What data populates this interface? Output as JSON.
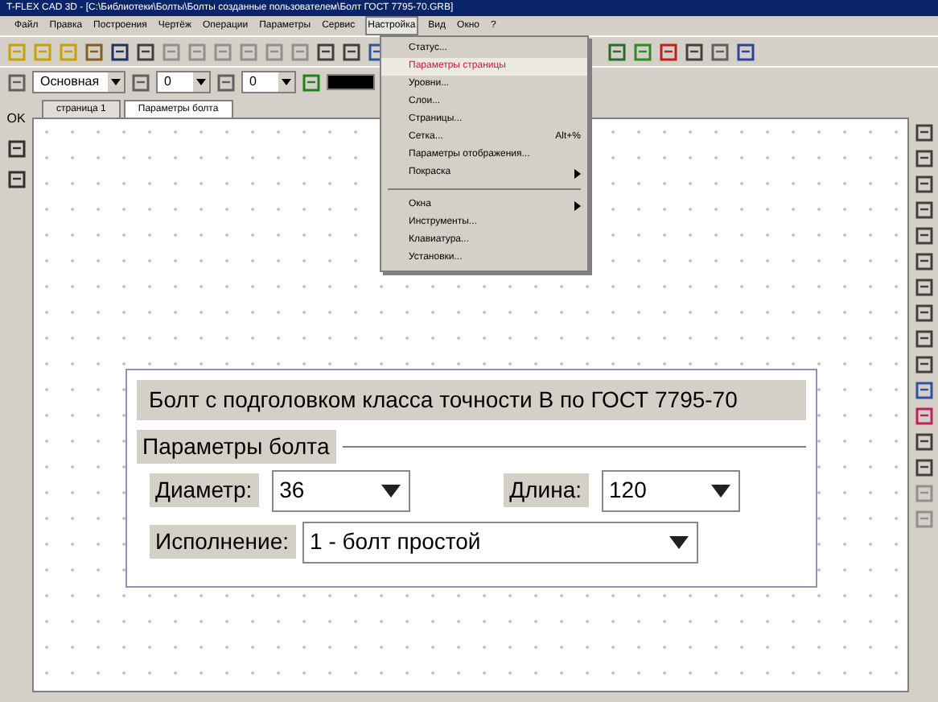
{
  "window": {
    "title": "T-FLEX CAD 3D - [C:\\Библиотеки\\Болты\\Болты созданные пользователем\\Болт ГОСТ 7795-70.GRB]"
  },
  "menubar": [
    {
      "label": "Файл",
      "selected": false
    },
    {
      "label": "Правка",
      "selected": false
    },
    {
      "label": "Построения",
      "selected": false
    },
    {
      "label": "Чертёж",
      "selected": false
    },
    {
      "label": "Операции",
      "selected": false
    },
    {
      "label": "Параметры",
      "selected": false
    },
    {
      "label": "Сервис",
      "selected": false
    },
    {
      "label": "Настройка",
      "selected": true
    },
    {
      "label": "Вид",
      "selected": false
    },
    {
      "label": "Окно",
      "selected": false
    },
    {
      "label": "?",
      "selected": false
    }
  ],
  "toolbar": {
    "layer": "Основная",
    "field_1": "0",
    "field_2": "0"
  },
  "menu": [
    {
      "kind": "item",
      "label": "Статус...",
      "selected": false
    },
    {
      "kind": "item",
      "label": "Параметры страницы",
      "selected": true
    },
    {
      "kind": "item",
      "label": "Уровни...",
      "selected": false
    },
    {
      "kind": "item",
      "label": "Слои...",
      "selected": false
    },
    {
      "kind": "item",
      "label": "Страницы...",
      "selected": false
    },
    {
      "kind": "item",
      "label": "Сетка...",
      "shortcut": "Alt+%",
      "selected": false
    },
    {
      "kind": "item",
      "label": "Параметры отображения...",
      "selected": false
    },
    {
      "kind": "submenu",
      "label": "Покраска",
      "selected": false
    },
    {
      "kind": "separator"
    },
    {
      "kind": "submenu",
      "label": "Окна",
      "selected": false
    },
    {
      "kind": "item",
      "label": "Инструменты...",
      "selected": false
    },
    {
      "kind": "item",
      "label": "Клавиатура...",
      "selected": false
    },
    {
      "kind": "item",
      "label": "Установки...",
      "selected": false
    }
  ],
  "tabs": [
    {
      "label": "страница 1",
      "selected": false
    },
    {
      "label": "Параметры болта",
      "selected": true
    }
  ],
  "side_panel": {
    "ok": "OK"
  },
  "dialog": {
    "title": "Болт с подголовком класса точности В по ГОСТ 7795-70",
    "group": "Параметры болта",
    "diameter_label": "Диаметр:",
    "diameter": "36",
    "length_label": "Длина:",
    "length": "120",
    "variant_label": "Исполнение:",
    "variant": "1 - болт простой"
  }
}
